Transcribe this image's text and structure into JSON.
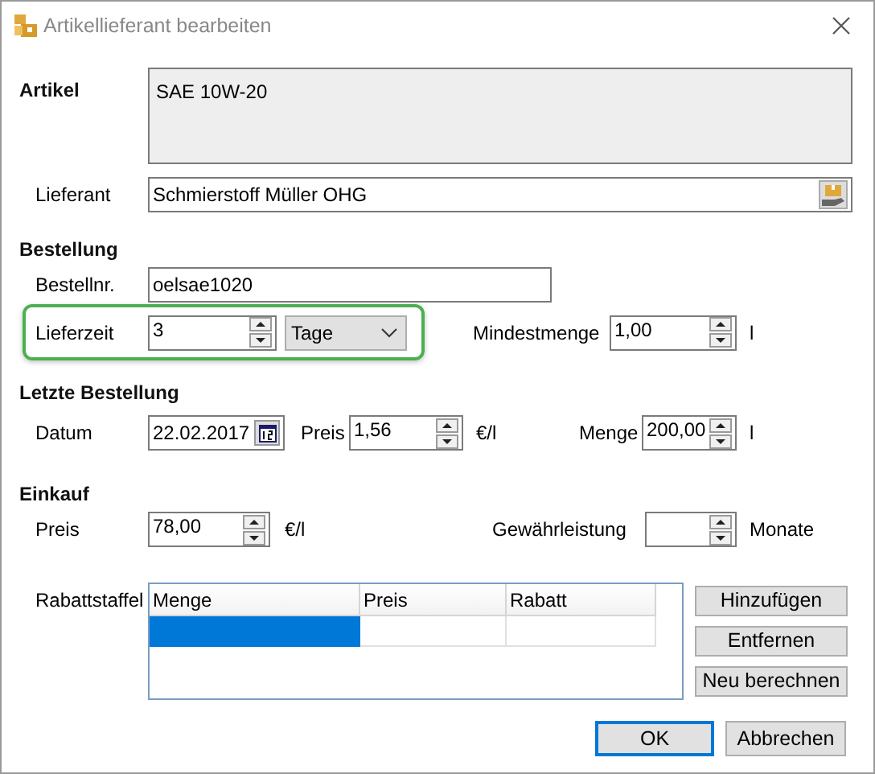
{
  "window": {
    "title": "Artikellieferant bearbeiten"
  },
  "artikel": {
    "label": "Artikel",
    "value": "SAE 10W-20"
  },
  "lieferant": {
    "label": "Lieferant",
    "value": "Schmierstoff Müller OHG"
  },
  "bestellung": {
    "heading": "Bestellung",
    "bestellnr": {
      "label": "Bestellnr.",
      "value": "oelsae1020"
    },
    "lieferzeit": {
      "label": "Lieferzeit",
      "value": "3",
      "unit": "Tage",
      "highlighted": true
    },
    "mindestmenge": {
      "label": "Mindestmenge",
      "value": "1,00",
      "unit": "l"
    }
  },
  "letzte_bestellung": {
    "heading": "Letzte Bestellung",
    "datum": {
      "label": "Datum",
      "value": "22.02.2017"
    },
    "preis": {
      "label": "Preis",
      "value": "1,56",
      "unit": "€/l"
    },
    "menge": {
      "label": "Menge",
      "value": "200,00",
      "unit": "l"
    }
  },
  "einkauf": {
    "heading": "Einkauf",
    "preis": {
      "label": "Preis",
      "value": "78,00",
      "unit": "€/l"
    },
    "gewaehrleistung": {
      "label": "Gewährleistung",
      "unit": "Monate"
    }
  },
  "rabattstaffel": {
    "label": "Rabattstaffel",
    "columns": [
      "Menge",
      "Preis",
      "Rabatt"
    ],
    "rows": [
      {
        "cells": [
          {
            "selected": true
          },
          {
            "selected": false
          },
          {
            "selected": false
          }
        ]
      }
    ]
  },
  "side_buttons": [
    "Hinzufügen",
    "Entfernen",
    "Neu berechnen"
  ],
  "buttons": [
    {
      "label": "OK",
      "default": true
    },
    {
      "label": "Abbrechen",
      "default": false
    }
  ]
}
